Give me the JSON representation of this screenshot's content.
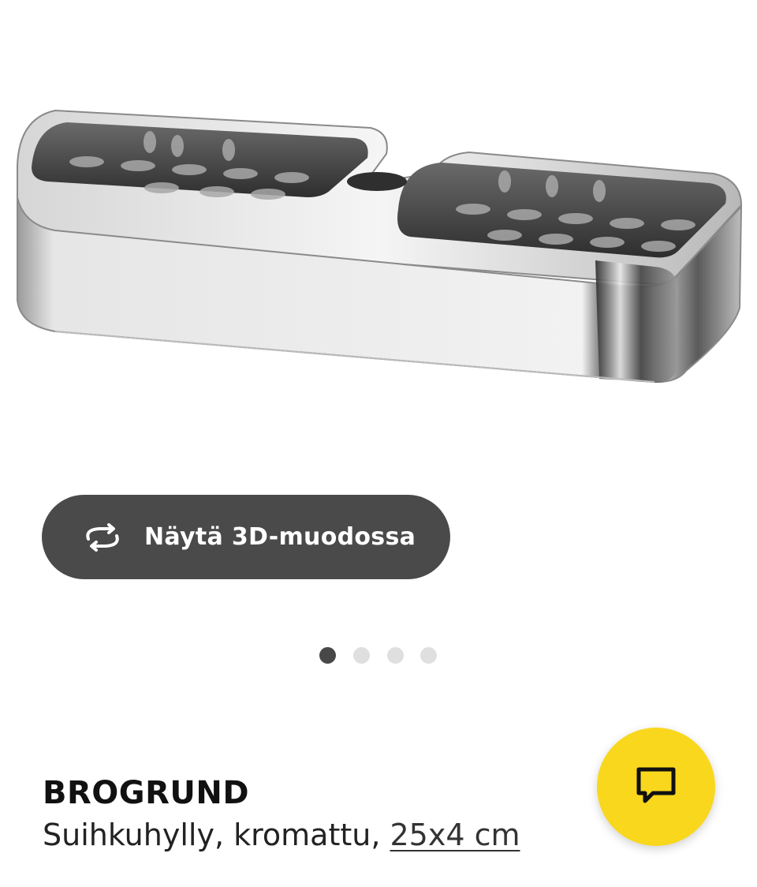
{
  "product": {
    "name": "BROGRUND",
    "description": "Suihkuhylly, kromattu, ",
    "size": "25x4 cm"
  },
  "view3d": {
    "label": "Näytä 3D-muodossa",
    "icon": "rotate-3d-icon"
  },
  "carousel": {
    "total": 4,
    "active_index": 0
  },
  "chat": {
    "icon": "chat-bubble-icon",
    "color": "#f9d71c"
  },
  "colors": {
    "button_bg": "#4a4a4a",
    "dot_active": "#484848",
    "dot_inactive": "#dfdfdf"
  }
}
